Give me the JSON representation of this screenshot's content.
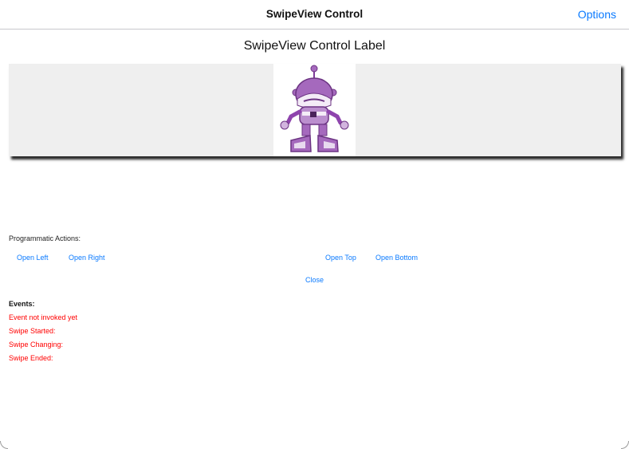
{
  "nav": {
    "title": "SwipeView Control",
    "options_label": "Options"
  },
  "page": {
    "label": "SwipeView Control Label"
  },
  "swipe_content": {
    "image_icon": "robot-mascot-icon",
    "background": "#efefef"
  },
  "actions": {
    "section_label": "Programmatic Actions:",
    "open_left": "Open Left",
    "open_right": "Open Right",
    "open_top": "Open Top",
    "open_bottom": "Open Bottom",
    "close": "Close"
  },
  "events": {
    "title": "Events:",
    "items": [
      "Event not invoked yet",
      "Swipe Started:",
      "Swipe Changing:",
      "Swipe Ended:"
    ]
  },
  "colors": {
    "accent": "#0a7aff",
    "event_text": "#ff0000",
    "robot": "#9b59b6"
  }
}
